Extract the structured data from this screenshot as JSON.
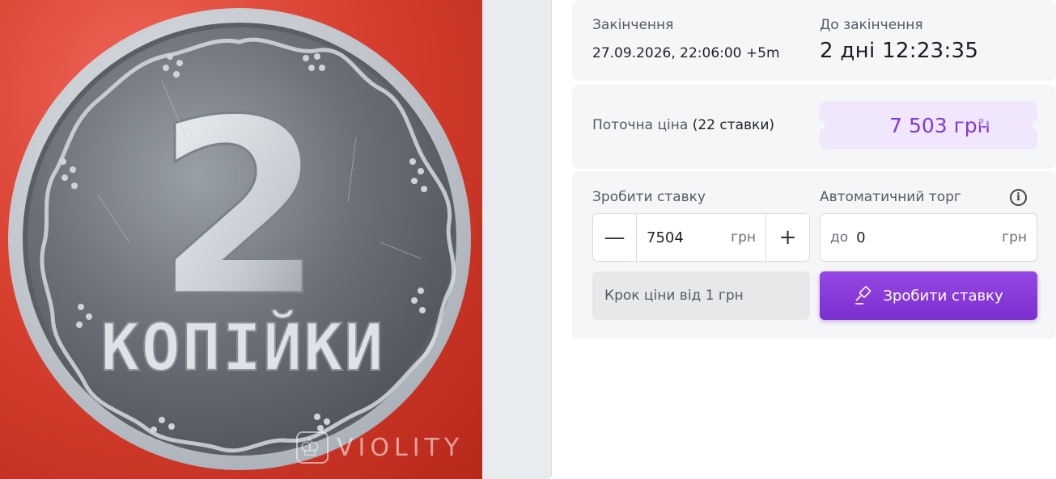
{
  "image": {
    "watermark_text": "VIOLITY",
    "coin": {
      "denomination": "2",
      "inscription": "КОПІЙКИ"
    }
  },
  "auction": {
    "end": {
      "label": "Закінчення",
      "value": "27.09.2026, 22:06:00 +5m"
    },
    "remaining": {
      "label": "До закінчення",
      "value": "2 дні 12:23:35"
    },
    "current_price": {
      "label": "Поточна ціна",
      "bids_count": "(22 ставки)",
      "value": "7 503 грн",
      "refresh_icon": "refresh-icon"
    },
    "bid": {
      "label": "Зробити ставку",
      "minus_symbol": "—",
      "plus_symbol": "+",
      "amount": "7504",
      "unit": "грн"
    },
    "auto_bid": {
      "label": "Автоматичний торг",
      "prefix": "до",
      "amount": "0",
      "unit": "грн",
      "info_symbol": "i"
    },
    "step_note": "Крок ціни від 1 грн",
    "submit_label": "Зробити ставку"
  },
  "colors": {
    "accent": "#8338d8",
    "button": "#8a3fdc",
    "price_bg": "#f0e7fd",
    "photo_bg": "#d8402f"
  }
}
